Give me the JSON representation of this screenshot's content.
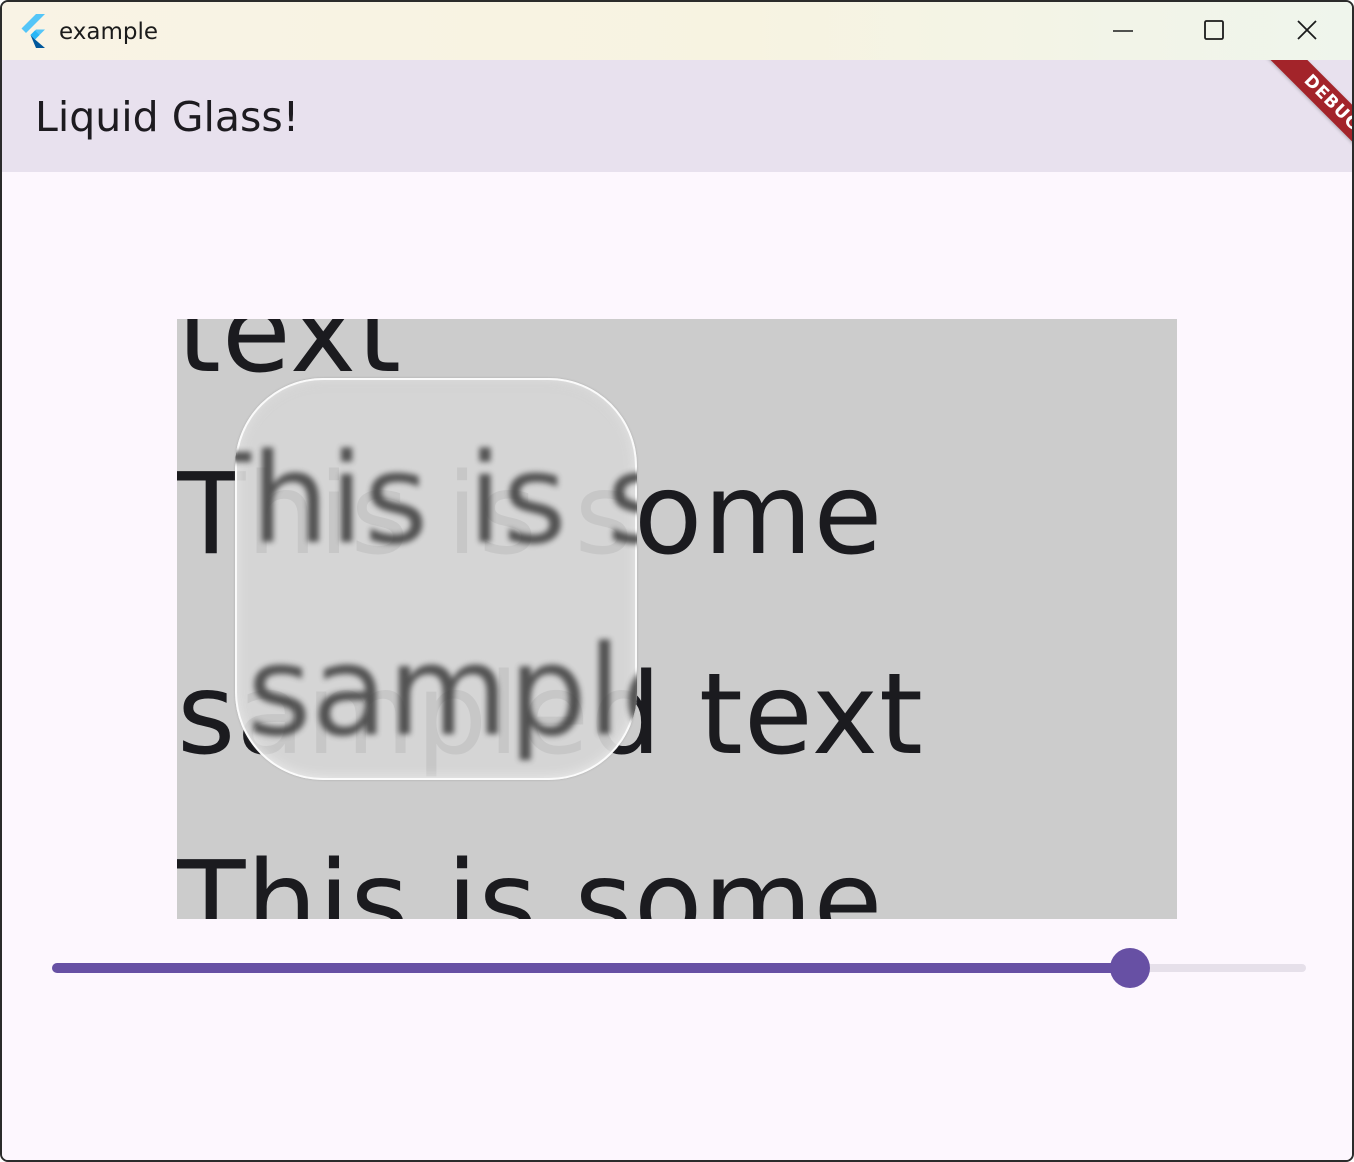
{
  "window": {
    "title": "example",
    "controls": {
      "minimize_icon": "minimize-icon",
      "maximize_icon": "maximize-icon",
      "close_icon": "close-icon"
    }
  },
  "appbar": {
    "title": "Liquid Glass!",
    "background": "#e8e1ee"
  },
  "debug_banner": {
    "label": "DEBUG",
    "color": "#a3242a"
  },
  "content": {
    "sample_lines": [
      "text",
      "This is some",
      "sampled text",
      "This is some"
    ],
    "glass_lines": [
      "This is some",
      "sample"
    ],
    "box_color": "#cccccc"
  },
  "slider": {
    "value": 0.86,
    "accent": "#6750a4",
    "inactive": "#e6e0ea"
  }
}
